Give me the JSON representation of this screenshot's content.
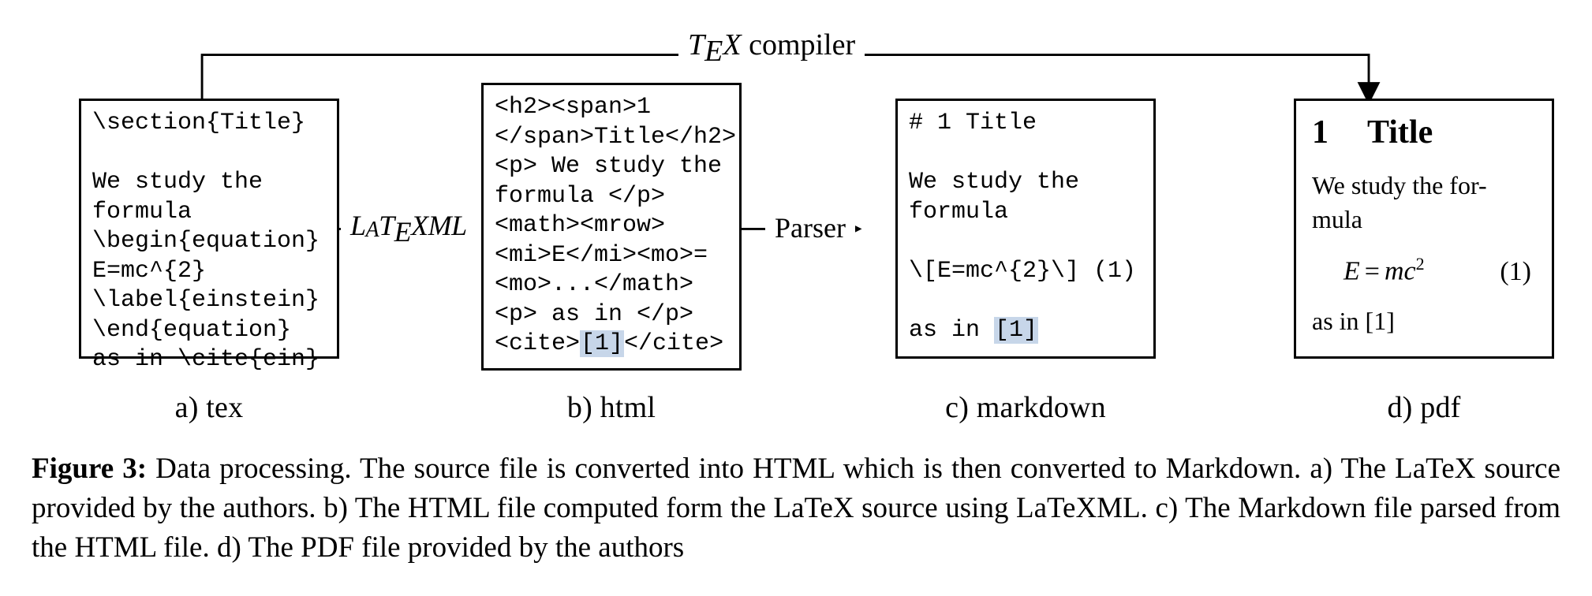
{
  "diagram": {
    "arrows": {
      "latexml_label_html": "L<span class=\"small-a\">A</span>T<span class=\"tex-e\">E</span>XML",
      "parser_label": "Parser",
      "tex_compiler_html": "<span class=\"tex\">T<span class=\"tex-e\">E</span>X</span> compiler"
    },
    "boxes": {
      "tex": {
        "label": "a) tex",
        "content": "\\section{Title}\n\nWe study the\nformula\n\\begin{equation}\nE=mc^{2}\n\\label{einstein}\n\\end{equation}\nas in \\cite{ein}"
      },
      "html": {
        "label": "b) html",
        "lines": [
          {
            "text": "<h2><span>1"
          },
          {
            "text": "</span>Title</h2>"
          },
          {
            "text": "<p> We study the"
          },
          {
            "text": "formula </p>"
          },
          {
            "text": "<math><mrow>"
          },
          {
            "text": "<mi>E</mi><mo>="
          },
          {
            "text": "<mo>...</math>"
          },
          {
            "text": "<p> as in </p>"
          },
          {
            "prefix": "<cite>",
            "hl": "[1]",
            "suffix": "</cite>"
          }
        ]
      },
      "markdown": {
        "label": "c) markdown",
        "lines": [
          {
            "text": "# 1 Title"
          },
          {
            "text": ""
          },
          {
            "text": "We study the"
          },
          {
            "text": "formula"
          },
          {
            "text": ""
          },
          {
            "text": "\\[E=mc^{2}\\] (1)"
          },
          {
            "text": ""
          },
          {
            "prefix": "as in ",
            "hl": "[1]",
            "suffix": ""
          }
        ]
      },
      "pdf": {
        "label": "d) pdf",
        "title_num": "1",
        "title_text": "Title",
        "body_line": "We study the for-​mula",
        "equation_lhs": "E",
        "equation_op": "=",
        "equation_rhs": "mc",
        "equation_sup": "2",
        "equation_number": "(1)",
        "tail": "as in [1]"
      }
    }
  },
  "caption": {
    "label": "Figure 3:",
    "text": "Data processing. The source file is converted into HTML which is then converted to Markdown. a) The LaTeX source provided by the authors. b) The HTML file computed form the LaTeX source using LaTeXML. c) The Markdown file parsed from the HTML file. d) The PDF file provided by the authors"
  }
}
